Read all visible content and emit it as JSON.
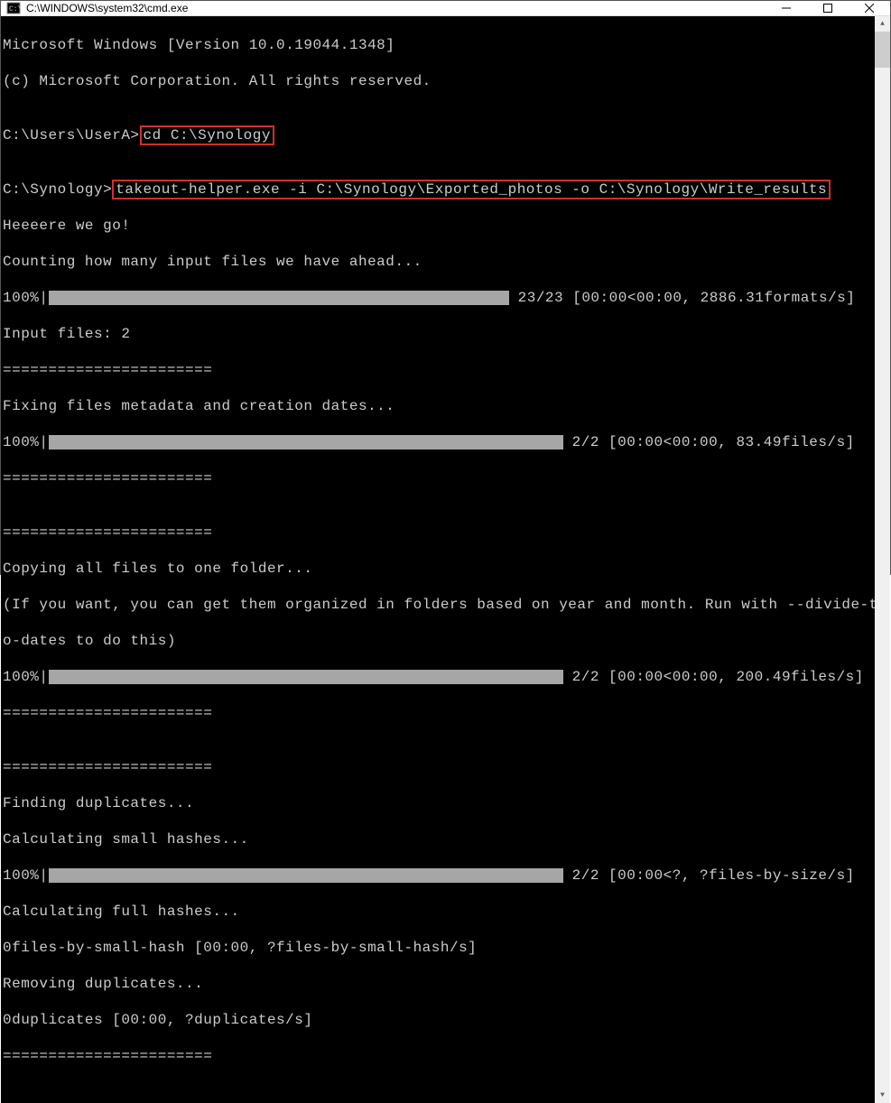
{
  "window": {
    "title": "C:\\WINDOWS\\system32\\cmd.exe"
  },
  "terminal": {
    "line1": "Microsoft Windows [Version 10.0.19044.1348]",
    "line2": "(c) Microsoft Corporation. All rights reserved.",
    "blank1": "",
    "prompt1_prefix": "C:\\Users\\UserA>",
    "prompt1_cmd": "cd C:\\Synology",
    "blank2": "",
    "prompt2_prefix": "C:\\Synology>",
    "prompt2_cmd": "takeout-helper.exe -i C:\\Synology\\Exported_photos -o C:\\Synology\\Write_results",
    "line_go": "Heeeere we go!",
    "line_count": "Counting how many input files we have ahead...",
    "prog1_label": "100%|",
    "prog1_stats": " 23/23 [00:00<00:00, 2886.31formats/s]",
    "line_inputfiles": "Input files: 2",
    "sep1": "=======================",
    "line_fixing": "Fixing files metadata and creation dates...",
    "prog2_label": "100%|",
    "prog2_stats": " 2/2 [00:00<00:00, 83.49files/s]",
    "sep2": "=======================",
    "blank3": "",
    "sep3": "=======================",
    "line_copying": "Copying all files to one folder...",
    "line_copying2a": "(If you want, you can get them organized in folders based on year and month. Run with --divide-t",
    "line_copying2b": "o-dates to do this)",
    "prog3_label": "100%|",
    "prog3_stats": " 2/2 [00:00<00:00, 200.49files/s]",
    "sep4": "=======================",
    "blank4": "",
    "sep5": "=======================",
    "line_finding": "Finding duplicates...",
    "line_calc_small": "Calculating small hashes...",
    "prog4_label": "100%|",
    "prog4_stats": " 2/2 [00:00<?, ?files-by-size/s]",
    "line_calc_full": "Calculating full hashes...",
    "line_files_small": "0files-by-small-hash [00:00, ?files-by-small-hash/s]",
    "line_removing": "Removing duplicates...",
    "line_dup": "0duplicates [00:00, ?duplicates/s]",
    "sep6": "======================="
  },
  "progress_widths": {
    "p1": 510,
    "p2": 570,
    "p3": 570,
    "p4": 570
  }
}
